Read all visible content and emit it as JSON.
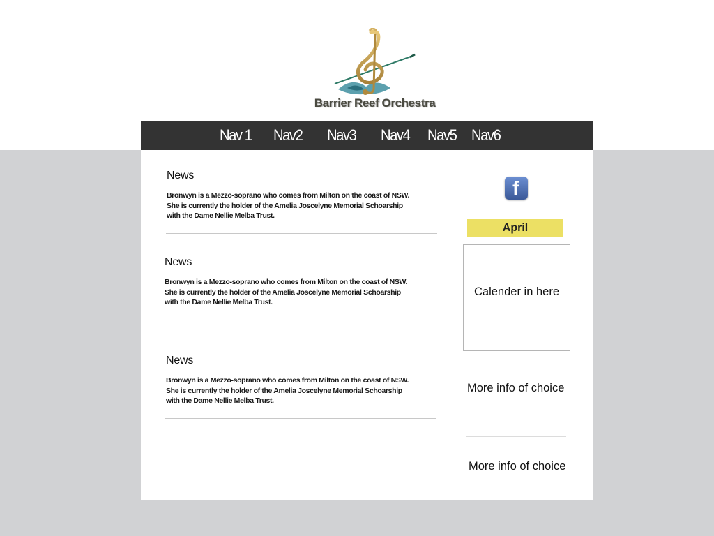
{
  "header": {
    "logo_text": "Barrier Reef Orchestra"
  },
  "nav": {
    "items": [
      "Nav 1",
      "Nav2",
      "Nav3",
      "Nav4",
      "Nav5",
      "Nav6"
    ]
  },
  "news": [
    {
      "title": "News",
      "body": "Bronwyn is a Mezzo-soprano who comes from Milton on the coast of NSW.\nShe is currently the holder of the Amelia Joscelyne Memorial Schoarship\nwith the Dame Nellie Melba Trust."
    },
    {
      "title": "News",
      "body": "Bronwyn is a Mezzo-soprano who comes from Milton on the coast of NSW.\nShe is currently the holder of the Amelia Joscelyne Memorial Schoarship\nwith the Dame Nellie Melba Trust."
    },
    {
      "title": "News",
      "body": "Bronwyn is a Mezzo-soprano who comes from Milton on the coast of NSW.\nShe is currently the holder of the Amelia Joscelyne Memorial Schoarship\nwith the Dame Nellie Melba Trust."
    }
  ],
  "sidebar": {
    "facebook_icon": "facebook-icon",
    "facebook_letter": "f",
    "month": "April",
    "calendar_placeholder": "Calender in here",
    "more_info_1": "More info of choice",
    "more_info_2": "More info of choice"
  },
  "colors": {
    "navbar": "#333333",
    "page_background": "#d1d2d4",
    "month_bar": "#ece064",
    "facebook_blue": "#3b5998"
  }
}
